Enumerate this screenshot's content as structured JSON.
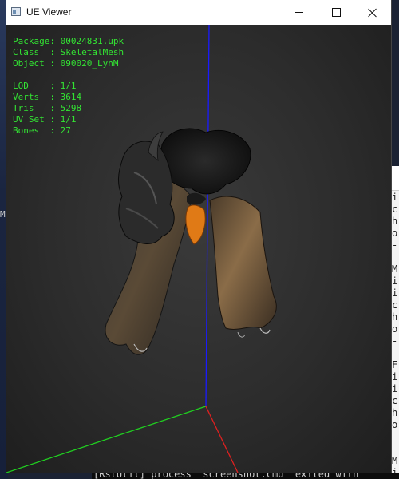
{
  "window": {
    "title": "UE Viewer"
  },
  "info": {
    "package_label": "Package: ",
    "package": "00024831.upk",
    "class_label": "Class  : ",
    "class": "SkeletalMesh",
    "object_label": "Object : ",
    "object": "090020_LynM",
    "lod_label": "LOD    : ",
    "lod": "1/1",
    "verts_label": "Verts  : ",
    "verts": "3614",
    "tris_label": "Tris   : ",
    "tris": "5298",
    "uvset_label": "UV Set : ",
    "uvset": "1/1",
    "bones_label": "Bones  : ",
    "bones": "27"
  },
  "background": {
    "desktop_glyph": "M",
    "console_lines": [
      "i",
      "c",
      "h",
      "o",
      "-",
      "",
      "M",
      "i",
      "i",
      "c",
      "h",
      "o",
      "-",
      "",
      "F",
      "i",
      "i",
      "c",
      "h",
      "o",
      "-",
      "",
      "M",
      "i"
    ],
    "bottom_console": "[RstUtil] process \"screenshot.cmd\" exited with"
  },
  "colors": {
    "info_text": "#33e433",
    "axis_x": "#e02020",
    "axis_y": "#20d020",
    "axis_z": "#1a1aff",
    "accent_orange": "#e07a16"
  },
  "icons": {
    "app": "app-window-icon",
    "minimize": "minimize-icon",
    "maximize": "maximize-icon",
    "close": "close-icon"
  }
}
